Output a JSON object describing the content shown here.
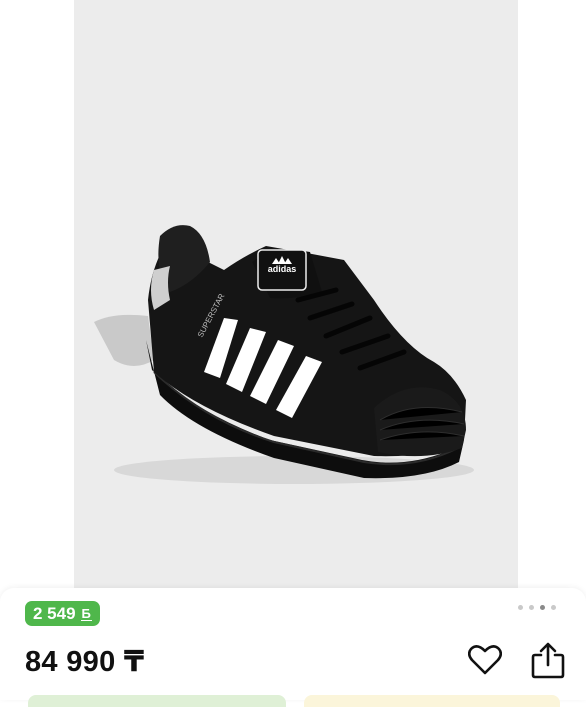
{
  "product": {
    "image_alt": "Black adidas Superstar sneaker with white stripes",
    "bonus": "2 549",
    "bonus_icon": "bonus-currency-icon",
    "price": "84 990 ₸",
    "gallery_dots": 4,
    "gallery_active_index": 2
  },
  "colors": {
    "bonus_badge": "#4fb74b",
    "photo_background": "#ececec",
    "text": "#111111"
  },
  "icons": {
    "favorite": "heart-icon",
    "share": "share-icon"
  }
}
